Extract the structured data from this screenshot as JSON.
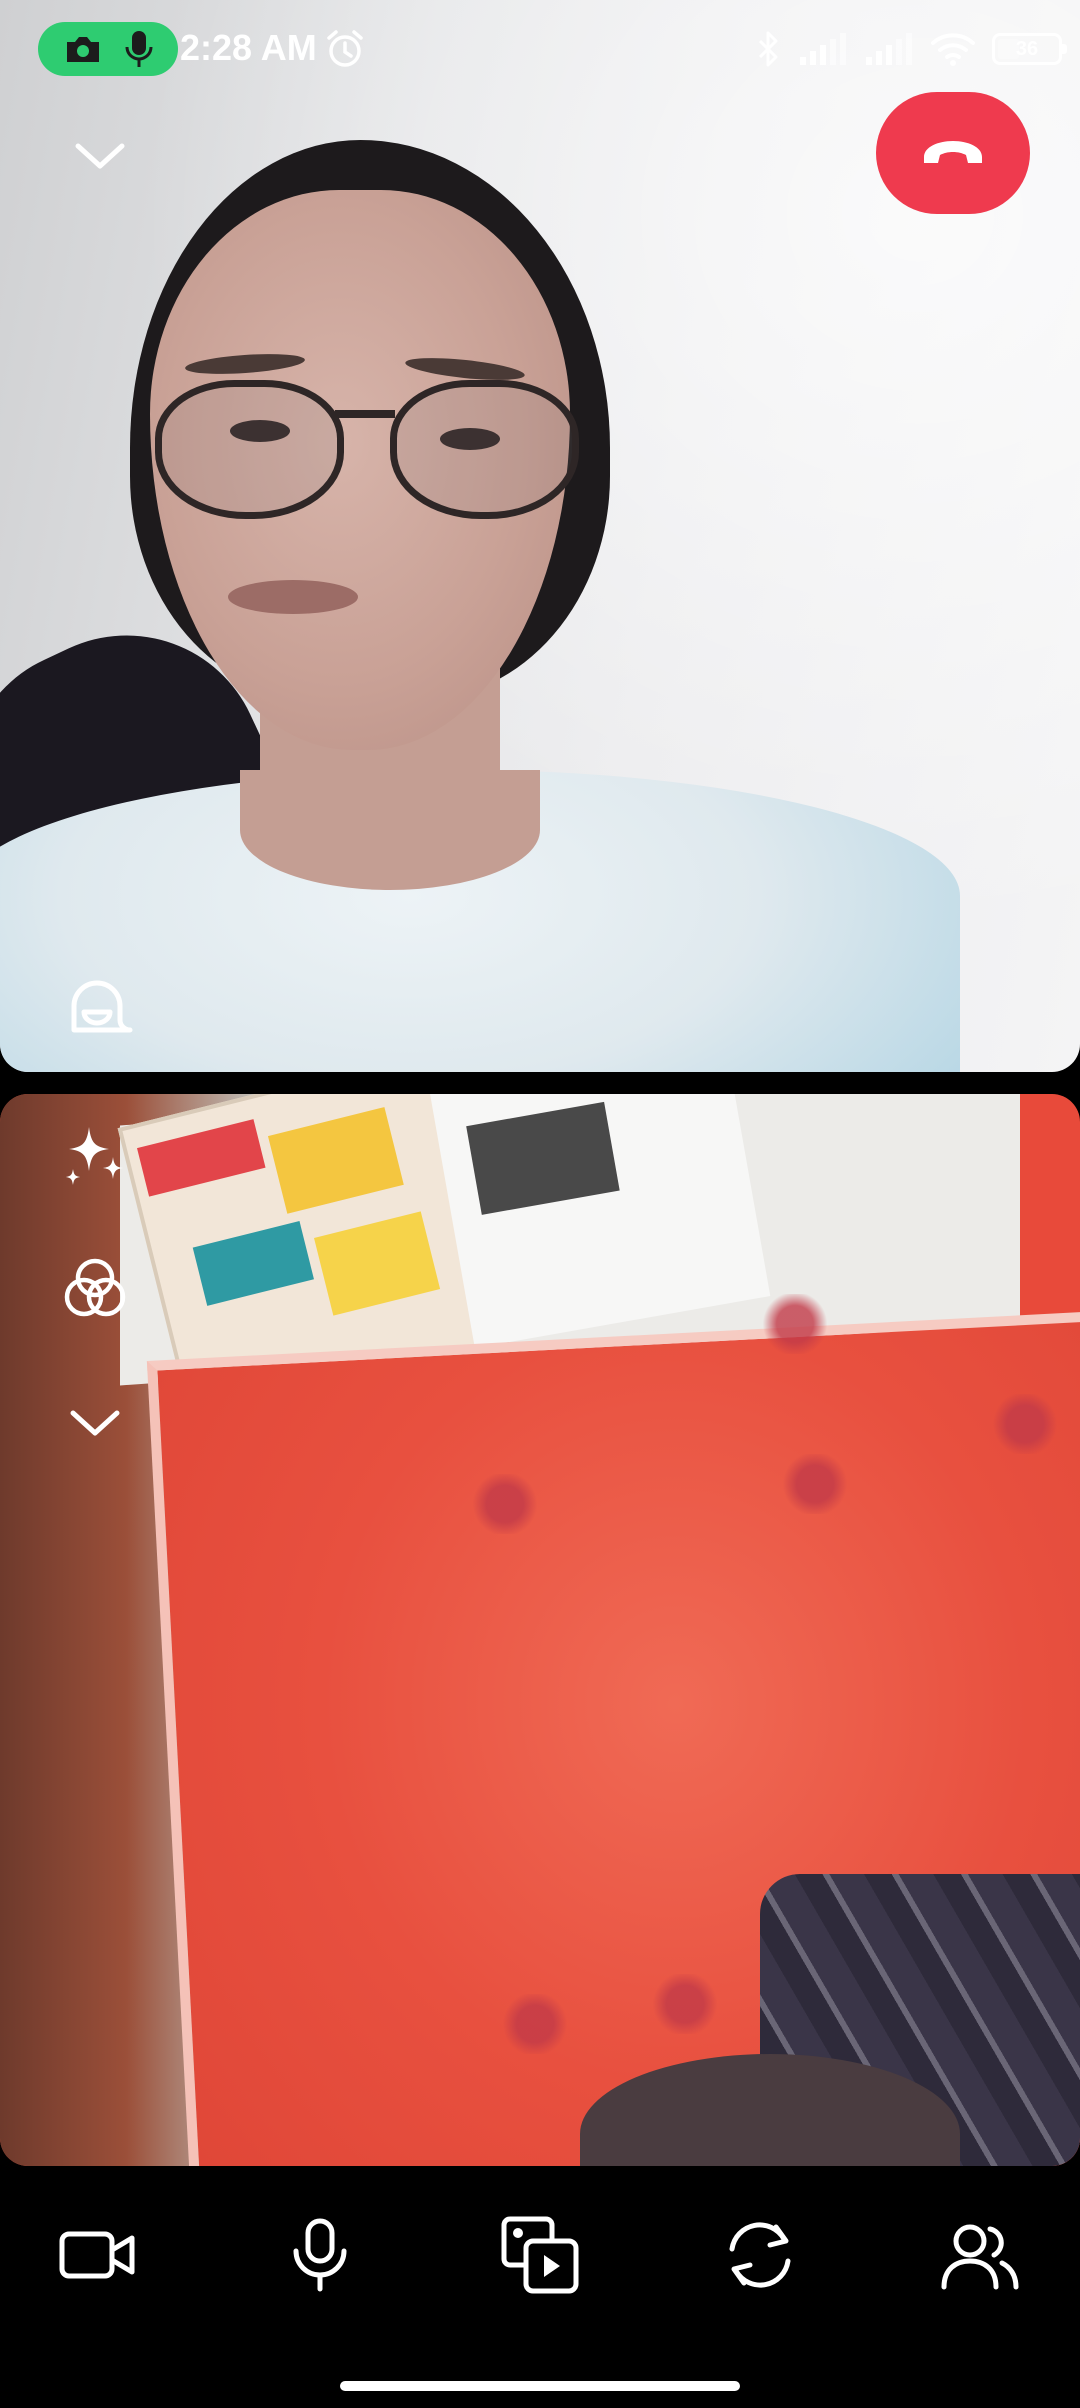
{
  "status_bar": {
    "time": "2:28 AM",
    "battery_level": "36",
    "battery_fraction": 0.36,
    "recording_indicator_color": "#2ecc71",
    "icons": [
      "camera-icon",
      "mic-icon",
      "alarm-icon",
      "bluetooth-icon",
      "signal-icon",
      "signal-icon",
      "wifi-icon",
      "battery-icon"
    ]
  },
  "call": {
    "end_call_color": "#ef3a4e",
    "top_controls": [
      "chevron-down-icon",
      "end-call-icon"
    ],
    "remote_overlay": [
      "lens-icon"
    ],
    "local_overlay": [
      "sparkles-icon",
      "filters-icon",
      "chevron-down-icon"
    ]
  },
  "toolbar": {
    "items": [
      "video-camera-icon",
      "microphone-icon",
      "media-share-icon",
      "flip-camera-icon",
      "participants-icon"
    ]
  }
}
